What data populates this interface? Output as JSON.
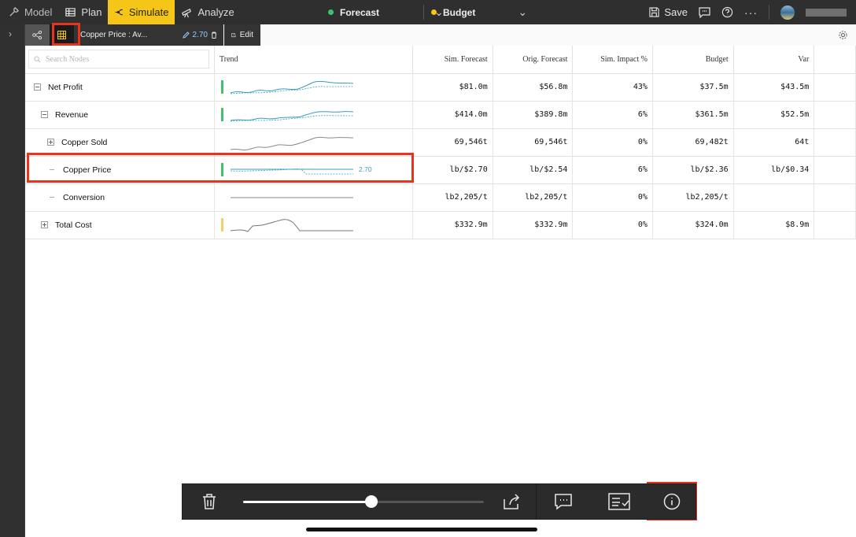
{
  "nav": {
    "model_label": "Model",
    "plan_label": "Plan",
    "simulate_label": "Simulate",
    "analyze_label": "Analyze"
  },
  "scenarios": {
    "primary": {
      "label": "Forecast",
      "color": "#3cc46a"
    },
    "secondary": {
      "label": "Budget",
      "color": "#f5c518"
    }
  },
  "tools": {
    "save_label": "Save"
  },
  "toolbar2": {
    "node_label": "Copper Price : Av...",
    "node_value": "2.70",
    "edit_label": "Edit"
  },
  "table": {
    "search_placeholder": "Search Nodes",
    "columns": {
      "trend": "Trend",
      "sim_forecast": "Sim. Forecast",
      "orig_forecast": "Orig. Forecast",
      "sim_impact": "Sim. Impact %",
      "budget": "Budget",
      "var": "Var"
    },
    "rows": [
      {
        "name": "Net Profit",
        "sim_forecast": "$81.0m",
        "orig_forecast": "$56.8m",
        "sim_impact": "43%",
        "budget": "$37.5m",
        "var": "$43.5m"
      },
      {
        "name": "Revenue",
        "sim_forecast": "$414.0m",
        "orig_forecast": "$389.8m",
        "sim_impact": "6%",
        "budget": "$361.5m",
        "var": "$52.5m"
      },
      {
        "name": "Copper Sold",
        "sim_forecast": "69,546t",
        "orig_forecast": "69,546t",
        "sim_impact": "0%",
        "budget": "69,482t",
        "var": "64t"
      },
      {
        "name": "Copper Price",
        "trend_value": "2.70",
        "sim_forecast": "lb/$2.70",
        "orig_forecast": "lb/$2.54",
        "sim_impact": "6%",
        "budget": "lb/$2.36",
        "var": "lb/$0.34"
      },
      {
        "name": "Conversion",
        "sim_forecast": "lb2,205/t",
        "orig_forecast": "lb2,205/t",
        "sim_impact": "0%",
        "budget": "lb2,205/t",
        "var": ""
      },
      {
        "name": "Total Cost",
        "sim_forecast": "$332.9m",
        "orig_forecast": "$332.9m",
        "sim_impact": "0%",
        "budget": "$324.0m",
        "var": "$8.9m"
      }
    ]
  },
  "bottom": {
    "slider_level": 0.53
  },
  "colors": {
    "accent": "#f5c518",
    "highlight": "#e8341c",
    "trend_blue": "#3b9cc0",
    "trend_green": "#3cc46a"
  }
}
